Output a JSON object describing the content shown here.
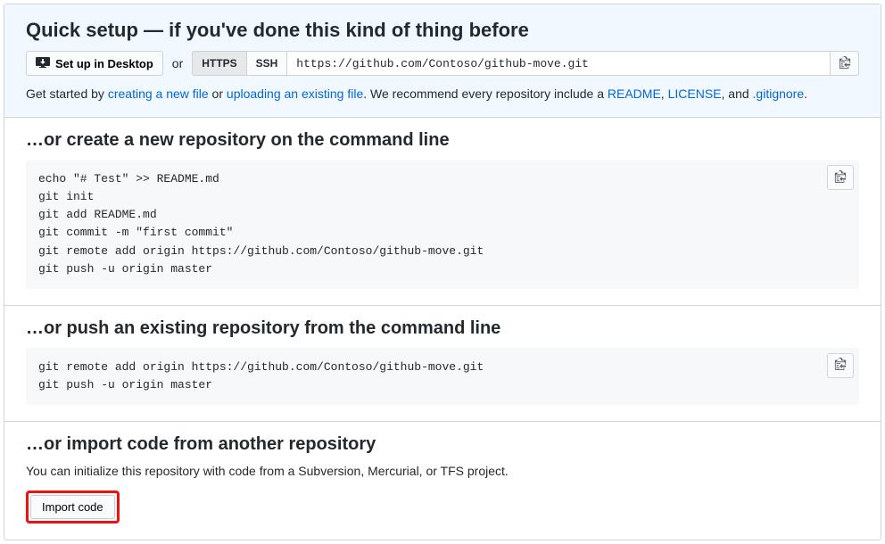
{
  "quick": {
    "title": "Quick setup — if you've done this kind of thing before",
    "desktop_label": "Set up in Desktop",
    "or_label": "or",
    "https_label": "HTTPS",
    "ssh_label": "SSH",
    "clone_url": "https://github.com/Contoso/github-move.git",
    "help_before": "Get started by ",
    "link_create": "creating a new file",
    "help_or": " or ",
    "link_upload": "uploading an existing file",
    "help_after1": ". We recommend every repository include a ",
    "link_readme": "README",
    "comma1": ", ",
    "link_license": "LICENSE",
    "comma2": ", and ",
    "link_gitignore": ".gitignore",
    "period": "."
  },
  "section_create": {
    "title": "…or create a new repository on the command line",
    "code": "echo \"# Test\" >> README.md\ngit init\ngit add README.md\ngit commit -m \"first commit\"\ngit remote add origin https://github.com/Contoso/github-move.git\ngit push -u origin master"
  },
  "section_push": {
    "title": "…or push an existing repository from the command line",
    "code": "git remote add origin https://github.com/Contoso/github-move.git\ngit push -u origin master"
  },
  "section_import": {
    "title": "…or import code from another repository",
    "desc": "You can initialize this repository with code from a Subversion, Mercurial, or TFS project.",
    "button_label": "Import code"
  }
}
